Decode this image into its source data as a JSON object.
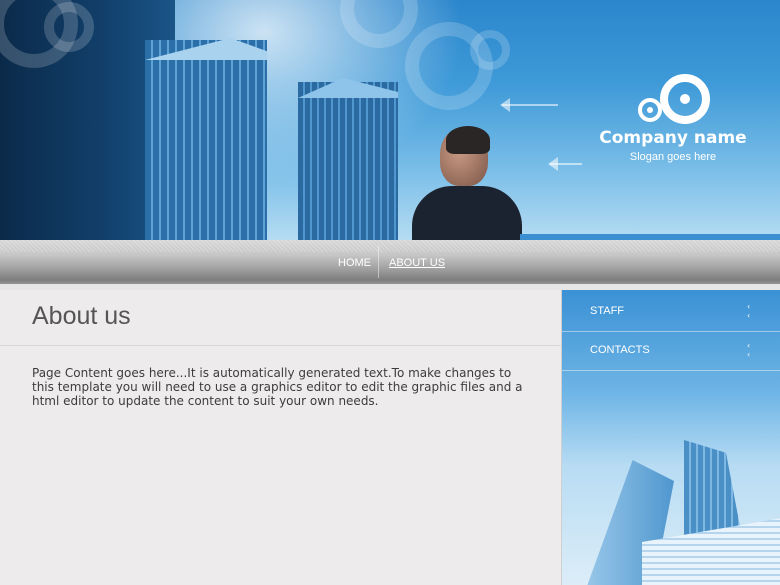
{
  "header": {
    "company_name": "Company name",
    "slogan": "Slogan goes here",
    "logo_icon": "two-rings-logo-icon"
  },
  "nav": {
    "items": [
      {
        "label": "HOME",
        "active": false
      },
      {
        "label": "ABOUT US",
        "active": true
      }
    ]
  },
  "main": {
    "title": "About us",
    "content": "Page Content goes here...It is automatically generated text.To make changes to this template you will need to use a graphics editor to edit the graphic files and a html editor to update the content to suit your own needs."
  },
  "sidebar": {
    "items": [
      {
        "label": "STAFF",
        "icon": "double-chevron-left-icon"
      },
      {
        "label": "CONTACTS",
        "icon": "double-chevron-left-icon"
      }
    ]
  },
  "colors": {
    "accent_blue": "#3a91d4",
    "content_bg": "#edebec",
    "title_gray": "#555555"
  }
}
